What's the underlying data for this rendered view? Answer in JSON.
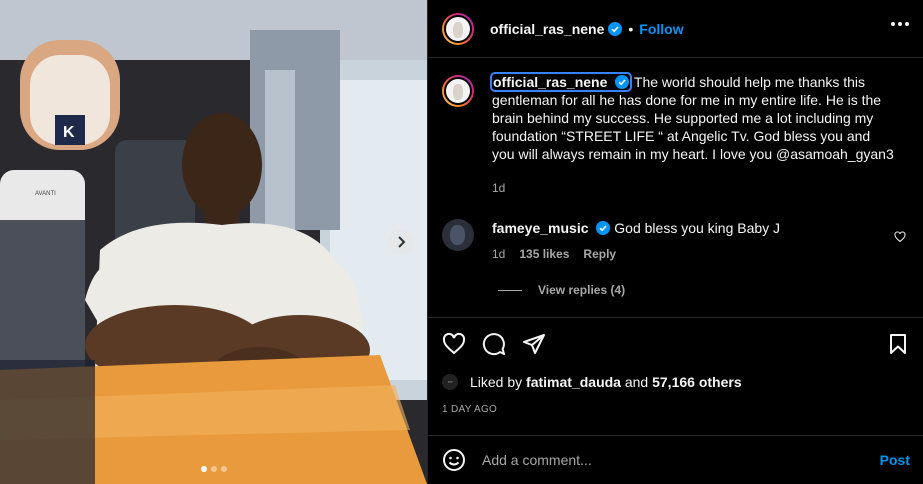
{
  "post": {
    "author": "official_ras_nene",
    "separator": "•",
    "follow_label": "Follow",
    "caption": "The world should help me thanks this gentleman for all he has done for me in my entire life. He is the brain behind my success. He supported me a lot including my foundation “STREET LIFE “ at Angelic Tv. God bless you and you will always remain in my heart. I love you @asamoah_gyan3",
    "caption_age": "1d",
    "carousel": {
      "slides": 3,
      "active_index": 0
    },
    "media_sign_text": "K",
    "media_seat_brand": "AVANTI"
  },
  "comments": [
    {
      "user": "fameye_music",
      "text": "God bless you king Baby J",
      "age": "1d",
      "likes": "135 likes",
      "reply_label": "Reply",
      "view_replies": "View replies (4)"
    }
  ],
  "likes": {
    "prefix": "Liked by",
    "user": "fatimat_dauda",
    "conjunction": "and",
    "count": "57,166 others"
  },
  "timestamp": "1 DAY AGO",
  "add_comment": {
    "placeholder": "Add a comment...",
    "post_label": "Post"
  },
  "colors": {
    "accent": "#0095f6",
    "background": "#000000",
    "secondary_text": "#a8a8a8",
    "verified": "#0095f6"
  },
  "icons": [
    "heart-icon",
    "comment-icon",
    "share-icon",
    "bookmark-icon",
    "emoji-icon",
    "more-icon",
    "verified-icon",
    "chevron-right-icon"
  ]
}
